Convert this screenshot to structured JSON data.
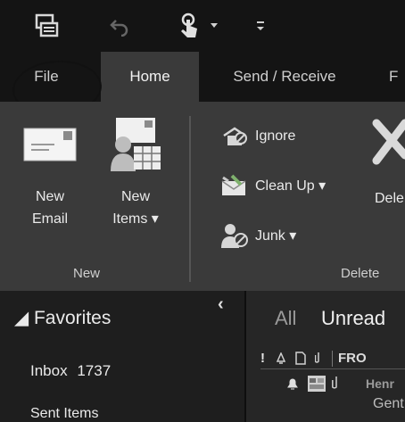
{
  "quick_access": {
    "icons": [
      "send-receive-icon",
      "undo-icon",
      "touch-mode-icon",
      "dropdown-arrow-icon",
      "customize-icon"
    ]
  },
  "tabs": [
    {
      "label": "File"
    },
    {
      "label": "Home"
    },
    {
      "label": "Send / Receive"
    },
    {
      "label": "F"
    }
  ],
  "ribbon": {
    "new_group": {
      "label": "New",
      "new_email": {
        "line1": "New",
        "line2": "Email"
      },
      "new_items": {
        "line1": "New",
        "line2": "Items ▾"
      }
    },
    "delete_group": {
      "label": "Delete",
      "ignore": "Ignore",
      "clean_up": "Clean Up ▾",
      "junk": "Junk ▾",
      "delete_partial": "Dele"
    }
  },
  "nav_pane": {
    "collapse_glyph": "‹",
    "favorites": "◢ Favorites",
    "inbox_label": "Inbox",
    "inbox_count": "1737",
    "sent_items": "Sent Items"
  },
  "message_list": {
    "filter_all": "All",
    "filter_unread": "Unread",
    "col_importance": "!",
    "col_from": "FRO",
    "row_sender": "Henr",
    "row_subject": "Gent"
  }
}
